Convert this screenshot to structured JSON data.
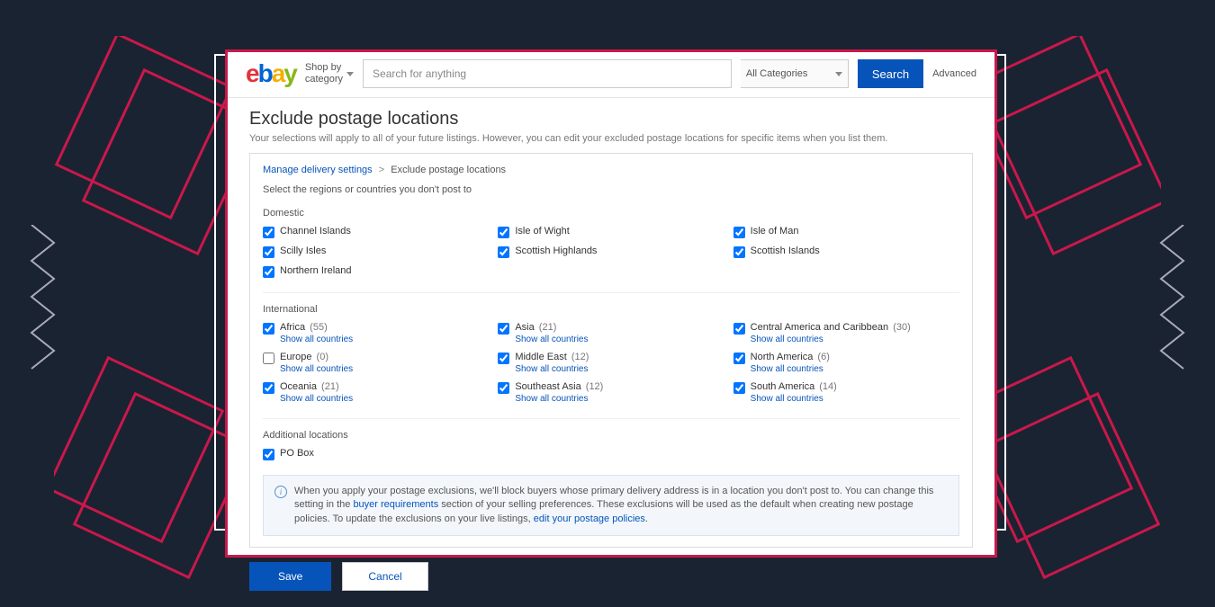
{
  "header": {
    "shop_by_line1": "Shop by",
    "shop_by_line2": "category",
    "search_placeholder": "Search for anything",
    "categories_label": "All Categories",
    "search_button": "Search",
    "advanced": "Advanced"
  },
  "page": {
    "title": "Exclude postage locations",
    "subtitle": "Your selections will apply to all of your future listings. However, you can edit your excluded postage locations for specific items when you list them."
  },
  "breadcrumb": {
    "parent": "Manage delivery settings",
    "current": "Exclude postage locations"
  },
  "instruction": "Select the regions or countries you don't post to",
  "sections": {
    "domestic": {
      "label": "Domestic",
      "items": [
        {
          "label": "Channel Islands",
          "checked": true
        },
        {
          "label": "Isle of Wight",
          "checked": true
        },
        {
          "label": "Isle of Man",
          "checked": true
        },
        {
          "label": "Scilly Isles",
          "checked": true
        },
        {
          "label": "Scottish Highlands",
          "checked": true
        },
        {
          "label": "Scottish Islands",
          "checked": true
        },
        {
          "label": "Northern Ireland",
          "checked": true
        }
      ]
    },
    "international": {
      "label": "International",
      "show_all": "Show all countries",
      "items": [
        {
          "label": "Africa",
          "count": "(55)",
          "checked": true
        },
        {
          "label": "Asia",
          "count": "(21)",
          "checked": true
        },
        {
          "label": "Central America and Caribbean",
          "count": "(30)",
          "checked": true
        },
        {
          "label": "Europe",
          "count": "(0)",
          "checked": false
        },
        {
          "label": "Middle East",
          "count": "(12)",
          "checked": true
        },
        {
          "label": "North America",
          "count": "(6)",
          "checked": true
        },
        {
          "label": "Oceania",
          "count": "(21)",
          "checked": true
        },
        {
          "label": "Southeast Asia",
          "count": "(12)",
          "checked": true
        },
        {
          "label": "South America",
          "count": "(14)",
          "checked": true
        }
      ]
    },
    "additional": {
      "label": "Additional locations",
      "items": [
        {
          "label": "PO Box",
          "checked": true
        }
      ]
    }
  },
  "info": {
    "text1": "When you apply your postage exclusions, we'll block buyers whose primary delivery address is in a location you don't post to. You can change this setting in the ",
    "link1": "buyer requirements",
    "text2": " section of your selling preferences. These exclusions will be used as the default when creating new postage policies. To update the exclusions on your live listings, ",
    "link2": "edit your postage policies",
    "text3": "."
  },
  "buttons": {
    "save": "Save",
    "cancel": "Cancel"
  }
}
